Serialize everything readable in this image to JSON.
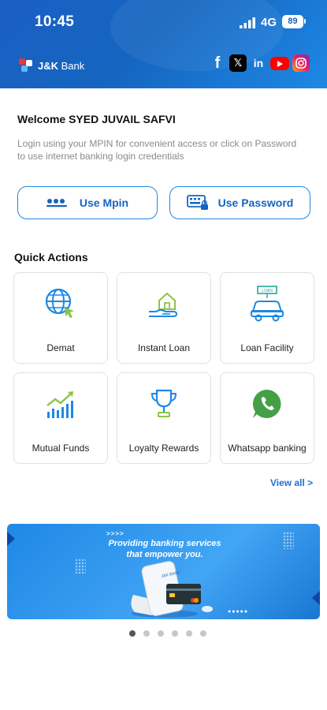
{
  "status_bar": {
    "time": "10:45",
    "network": "4G",
    "battery": "89"
  },
  "header": {
    "brand_name": "J&K",
    "brand_suffix": "Bank",
    "social": [
      "facebook-icon",
      "x-icon",
      "linkedin-icon",
      "youtube-icon",
      "instagram-icon"
    ]
  },
  "login": {
    "welcome": "Welcome SYED JUVAIL SAFVI",
    "subtext": "Login using your MPIN for convenient access or click on Password to use internet banking login credentials",
    "mpin_label": "Use Mpin",
    "password_label": "Use Password"
  },
  "quick_actions": {
    "title": "Quick Actions",
    "items": [
      {
        "label": "Demat",
        "icon": "globe-cursor-icon"
      },
      {
        "label": "Instant Loan",
        "icon": "hand-house-icon"
      },
      {
        "label": "Loan Facility",
        "icon": "car-loan-icon"
      },
      {
        "label": "Mutual Funds",
        "icon": "growth-chart-icon"
      },
      {
        "label": "Loyalty Rewards",
        "icon": "trophy-icon"
      },
      {
        "label": "Whatsapp banking",
        "icon": "whatsapp-icon"
      }
    ],
    "view_all": "View all >"
  },
  "banner": {
    "arrows": ">>>>",
    "headline_line1": "Providing banking services",
    "headline_line2": "that empower you.",
    "slides": 6,
    "active_slide": 1
  },
  "colors": {
    "primary": "#1565c0",
    "accent": "#1e88e5",
    "link": "#1e6fd9"
  }
}
